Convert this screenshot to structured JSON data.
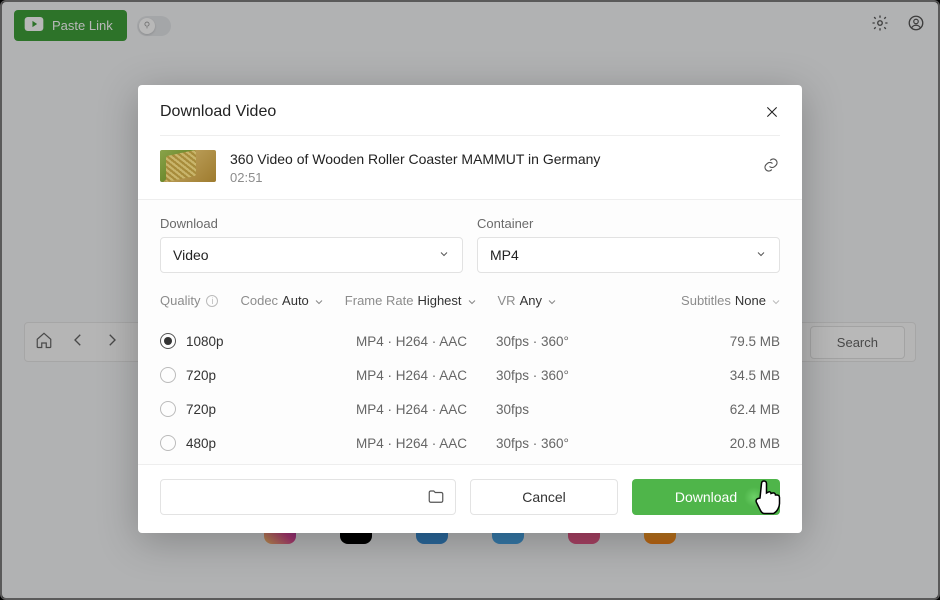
{
  "topbar": {
    "paste_link_label": "Paste Link"
  },
  "appbar": {
    "search_label": "Search"
  },
  "modal": {
    "title": "Download Video",
    "video": {
      "title": "360 Video of Wooden Roller Coaster MAMMUT in Germany",
      "duration": "02:51"
    },
    "download_label": "Download",
    "download_value": "Video",
    "container_label": "Container",
    "container_value": "MP4",
    "filters": {
      "quality_label": "Quality",
      "codec_label": "Codec",
      "codec_value": "Auto",
      "frame_rate_label": "Frame Rate",
      "frame_rate_value": "Highest",
      "vr_label": "VR",
      "vr_value": "Any",
      "subtitles_label": "Subtitles",
      "subtitles_value": "None"
    },
    "rows": [
      {
        "quality": "1080p",
        "codec": "MP4 · H264 · AAC",
        "fps": "30fps · 360°",
        "size": "79.5 MB",
        "selected": true
      },
      {
        "quality": "720p",
        "codec": "MP4 · H264 · AAC",
        "fps": "30fps · 360°",
        "size": "34.5 MB",
        "selected": false
      },
      {
        "quality": "720p",
        "codec": "MP4 · H264 · AAC",
        "fps": "30fps",
        "size": "62.4 MB",
        "selected": false
      },
      {
        "quality": "480p",
        "codec": "MP4 · H264 · AAC",
        "fps": "30fps · 360°",
        "size": "20.8 MB",
        "selected": false
      }
    ],
    "footer": {
      "cancel_label": "Cancel",
      "download_label": "Download"
    }
  },
  "logos": [
    {
      "name": "instagram",
      "bg": "linear-gradient(45deg,#fdc468,#df4996,#8134af)"
    },
    {
      "name": "black",
      "bg": "#000"
    },
    {
      "name": "blue",
      "bg": "#3b8fd6"
    },
    {
      "name": "bilibili",
      "bg": "#4aa7e8"
    },
    {
      "name": "sites",
      "bg": "#e85a8a"
    },
    {
      "name": "diamond",
      "bg": "linear-gradient(180deg,#ffcf4a,#ff8a1a)"
    }
  ]
}
